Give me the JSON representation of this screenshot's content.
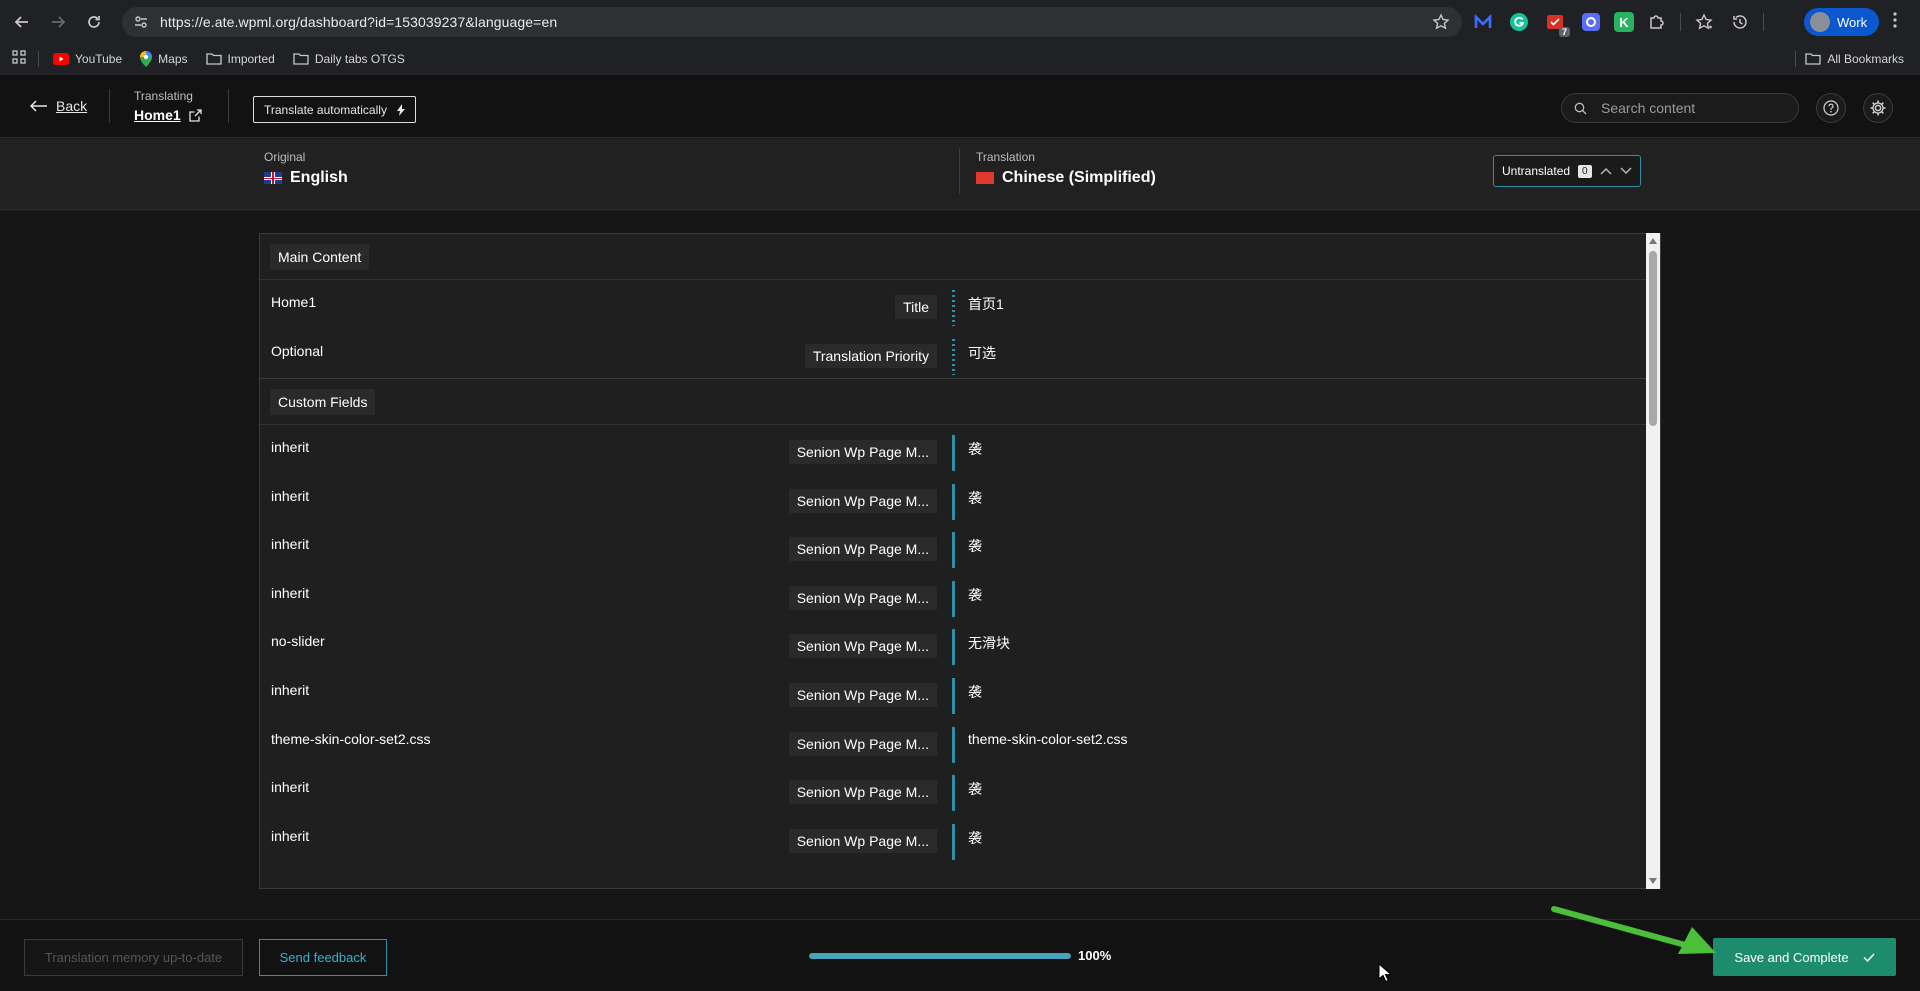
{
  "browser": {
    "url": "https://e.ate.wpml.org/dashboard?id=153039237&language=en",
    "profile_label": "Work",
    "extension_badge": "7",
    "extension_k": "K",
    "bookmarks": [
      {
        "label": "YouTube",
        "icon": "youtube-icon"
      },
      {
        "label": "Maps",
        "icon": "maps-icon"
      },
      {
        "label": "Imported",
        "icon": "folder-icon"
      },
      {
        "label": "Daily tabs OTGS",
        "icon": "folder-icon"
      }
    ],
    "all_bookmarks": "All Bookmarks"
  },
  "header": {
    "back_label": "Back",
    "translating_label": "Translating",
    "document_title": "Home1",
    "translate_auto_label": "Translate automatically",
    "search_placeholder": "Search content"
  },
  "languages": {
    "original_label": "Original",
    "original_lang": "English",
    "translation_label": "Translation",
    "translation_lang": "Chinese (Simplified)",
    "untranslated_label": "Untranslated",
    "untranslated_count": "0"
  },
  "sections": {
    "main": {
      "title": "Main Content",
      "rows": [
        {
          "original": "Home1",
          "field": "Title",
          "translation": "首页1"
        },
        {
          "original": "Optional",
          "field": "Translation Priority",
          "translation": "可选"
        }
      ]
    },
    "custom": {
      "title": "Custom Fields",
      "rows": [
        {
          "original": "inherit",
          "field": "Senion Wp Page M...",
          "translation": "袭"
        },
        {
          "original": "inherit",
          "field": "Senion Wp Page M...",
          "translation": "袭"
        },
        {
          "original": "inherit",
          "field": "Senion Wp Page M...",
          "translation": "袭"
        },
        {
          "original": "inherit",
          "field": "Senion Wp Page M...",
          "translation": "袭"
        },
        {
          "original": "no-slider",
          "field": "Senion Wp Page M...",
          "translation": "无滑块"
        },
        {
          "original": "inherit",
          "field": "Senion Wp Page M...",
          "translation": "袭"
        },
        {
          "original": "theme-skin-color-set2.css",
          "field": "Senion Wp Page M...",
          "translation": "theme-skin-color-set2.css"
        },
        {
          "original": "inherit",
          "field": "Senion Wp Page M...",
          "translation": "袭"
        },
        {
          "original": "inherit",
          "field": "Senion Wp Page M...",
          "translation": "袭"
        }
      ]
    }
  },
  "footer": {
    "tm_label": "Translation memory up-to-date",
    "feedback_label": "Send feedback",
    "progress_value": 1.0,
    "progress_label": "100%",
    "save_label": "Save and Complete"
  },
  "colors": {
    "accent": "#2f8fa6",
    "save_button": "#1d8c6e",
    "annotation_arrow": "#4bbf3a"
  }
}
